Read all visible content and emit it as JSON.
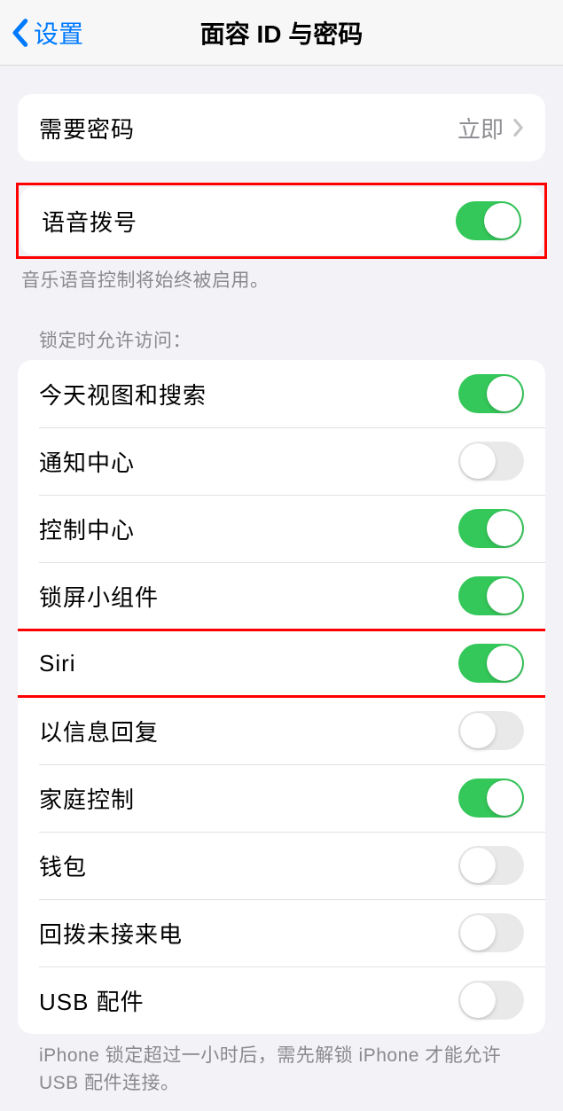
{
  "nav": {
    "back_label": "设置",
    "title": "面容 ID 与密码"
  },
  "require_passcode": {
    "label": "需要密码",
    "value": "立即"
  },
  "voice_dial": {
    "label": "语音拨号",
    "footer": "音乐语音控制将始终被启用。",
    "on": true
  },
  "locked_access": {
    "header": "锁定时允许访问：",
    "items": [
      {
        "label": "今天视图和搜索",
        "on": true
      },
      {
        "label": "通知中心",
        "on": false
      },
      {
        "label": "控制中心",
        "on": true
      },
      {
        "label": "锁屏小组件",
        "on": true
      },
      {
        "label": "Siri",
        "on": true
      },
      {
        "label": "以信息回复",
        "on": false
      },
      {
        "label": "家庭控制",
        "on": true
      },
      {
        "label": "钱包",
        "on": false
      },
      {
        "label": "回拨未接来电",
        "on": false
      },
      {
        "label": "USB 配件",
        "on": false
      }
    ],
    "footer": "iPhone 锁定超过一小时后，需先解锁 iPhone 才能允许 USB 配件连接。"
  }
}
